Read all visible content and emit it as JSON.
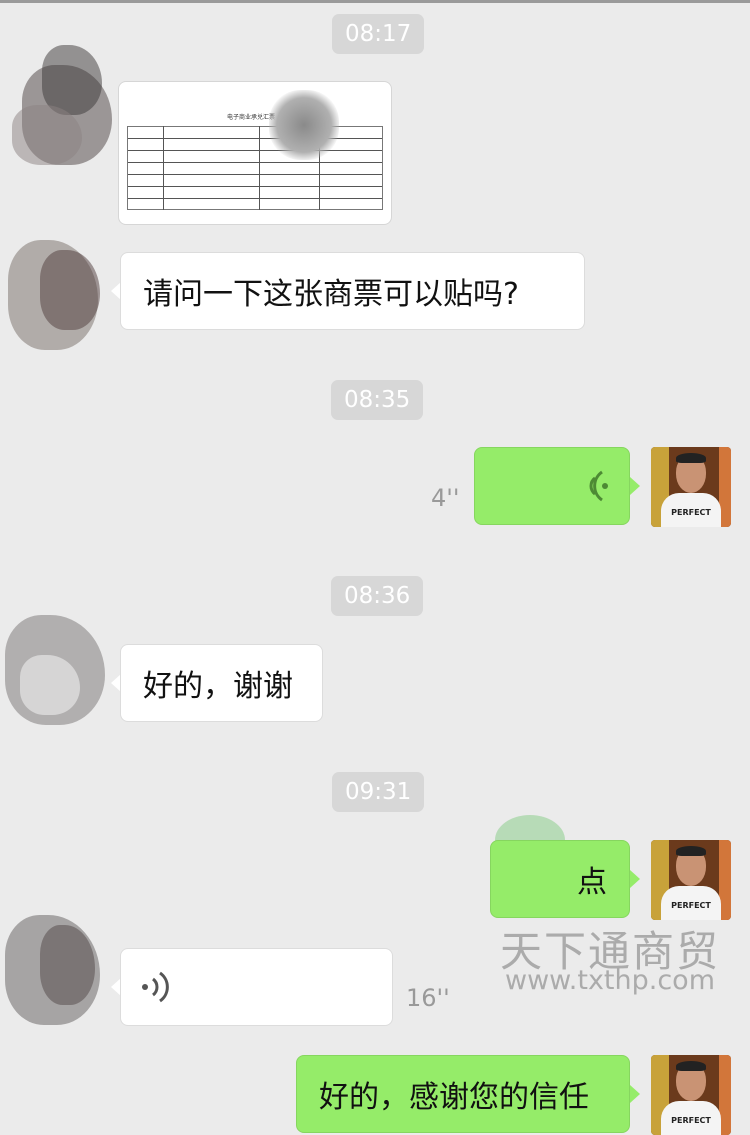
{
  "timestamps": [
    "08:17",
    "08:35",
    "08:36",
    "09:31"
  ],
  "messages": {
    "m2_text": "请问一下这张商票可以贴吗?",
    "m3_duration": "4''",
    "m4_text": "好的，谢谢",
    "m5_text": "点",
    "m6_duration": "16''",
    "m7_text": "好的，感谢您的信任"
  },
  "avatar_me": {
    "shirt_text": "PERFECT"
  },
  "icons": {
    "voice_out": "voice-wave-icon",
    "voice_in": "voice-wave-icon"
  },
  "watermark": {
    "cn": "天下通商贸",
    "url": "www.txthp.com"
  },
  "colors": {
    "background": "#ebebeb",
    "bubble_green": "#95ec69",
    "bubble_white": "#ffffff",
    "timestamp_bg": "#d7d7d7"
  }
}
